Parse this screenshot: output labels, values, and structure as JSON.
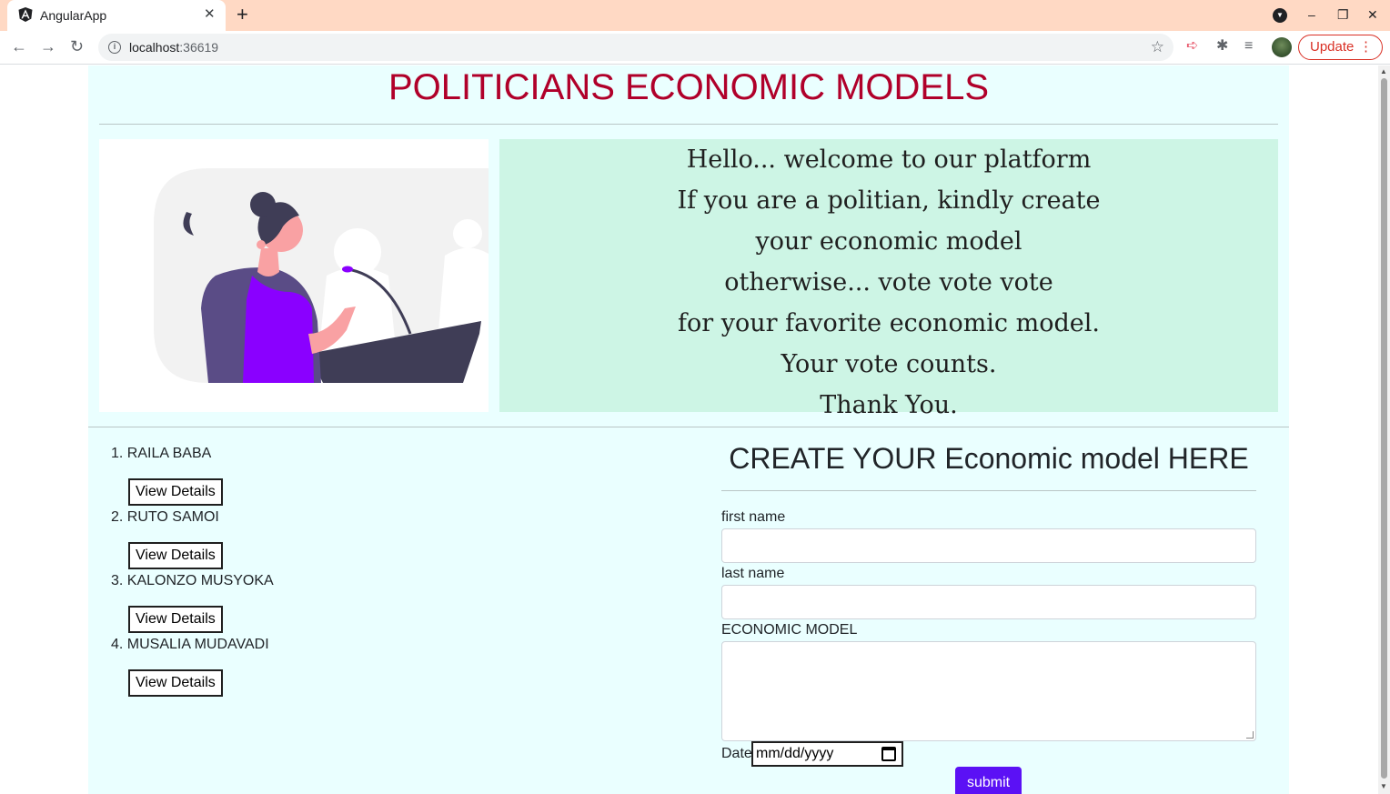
{
  "browser": {
    "tab_title": "AngularApp",
    "new_tab_symbol": "+",
    "tab_close_symbol": "✕",
    "url_host": "localhost",
    "url_port": ":36619",
    "update_label": "Update",
    "window_controls": {
      "minimize": "–",
      "restore": "❐",
      "close": "✕"
    }
  },
  "page": {
    "title": "POLITICIANS ECONOMIC MODELS",
    "welcome_lines": [
      "Hello... welcome to our platform",
      "If you are a politian, kindly create",
      "your economic model",
      "otherwise... vote vote vote",
      "for your favorite economic model.",
      "Your vote counts.",
      "Thank You."
    ],
    "politicians": [
      {
        "number": "1.",
        "name": "RAILA BABA",
        "button": "View Details"
      },
      {
        "number": "2.",
        "name": "RUTO SAMOI",
        "button": "View Details"
      },
      {
        "number": "3.",
        "name": "KALONZO MUSYOKA",
        "button": "View Details"
      },
      {
        "number": "4.",
        "name": "MUSALIA MUDAVADI",
        "button": "View Details"
      }
    ],
    "form": {
      "title": "CREATE YOUR Economic model HERE",
      "first_name_label": "first name",
      "first_name_value": "",
      "last_name_label": "last name",
      "last_name_value": "",
      "model_label": "ECONOMIC MODEL",
      "model_value": "",
      "date_label": "Date",
      "date_placeholder": "mm/dd/yyyy",
      "submit_label": "submit"
    }
  },
  "colors": {
    "title_red": "#b0002a",
    "container_bg": "#eaffff",
    "welcome_bg": "#cdf5e5",
    "submit_bg": "#5b11f5",
    "tabstrip_bg": "#ffd9c4"
  }
}
